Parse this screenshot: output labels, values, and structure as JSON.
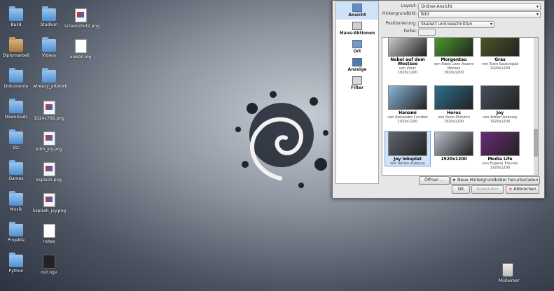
{
  "desktop": {
    "icons": [
      {
        "label": "Build",
        "type": "folder"
      },
      {
        "label": "Studium",
        "type": "folder-img"
      },
      {
        "label": "screenshot2.png",
        "type": "img"
      },
      {
        "label": "Diplomarbeit",
        "type": "folder-brown"
      },
      {
        "label": "Videos",
        "type": "folder-video"
      },
      {
        "label": "unison.log",
        "type": "txt"
      },
      {
        "label": "Dokumente",
        "type": "folder"
      },
      {
        "label": "wheezy_artwork",
        "type": "folder"
      },
      {
        "label": "Downloads",
        "type": "folder-green"
      },
      {
        "label": "1024x768.png",
        "type": "img"
      },
      {
        "label": "Etc",
        "type": "folder"
      },
      {
        "label": "kdm_joy.png",
        "type": "img"
      },
      {
        "label": "Games",
        "type": "folder-red"
      },
      {
        "label": "ksplash.png",
        "type": "img"
      },
      {
        "label": "Musik",
        "type": "folder-green"
      },
      {
        "label": "ksplash_joy.png",
        "type": "img"
      },
      {
        "label": "Projekte",
        "type": "folder"
      },
      {
        "label": "notes",
        "type": "txt"
      },
      {
        "label": "Python",
        "type": "folder"
      },
      {
        "label": "out.ogv",
        "type": "video"
      }
    ],
    "trash_label": "Mülleimer"
  },
  "dialog": {
    "sidebar": [
      {
        "label": "Ansicht",
        "icon": "monitor-icon",
        "active": true
      },
      {
        "label": "Maus-Aktionen",
        "icon": "mouse-icon",
        "active": false
      },
      {
        "label": "Ort",
        "icon": "window-icon",
        "active": false
      },
      {
        "label": "Anzeige",
        "icon": "display-icon",
        "active": false
      },
      {
        "label": "Filter",
        "icon": "funnel-icon",
        "active": false
      }
    ],
    "layout_label": "Layout:",
    "layout_value": "Ordner-Ansicht",
    "background_label": "Hintergrundbild:",
    "background_value": "Bild",
    "position_label": "Positionierung:",
    "position_value": "Skaliert und beschnitten",
    "color_label": "Farbe:",
    "wallpapers": [
      {
        "name": "Nebel auf dem Westsee",
        "author": "von Vinac",
        "size": "1920x1200",
        "color": "#d9d9d9"
      },
      {
        "name": "Morgentau",
        "author": "von Pablo León-Asuero Moreno",
        "size": "1920x1200",
        "color": "#4ea52e"
      },
      {
        "name": "Gras",
        "author": "von Risto Saukonpää",
        "size": "1920x1200",
        "color": "#4f5a28"
      },
      {
        "name": "Hanami",
        "author": "von Alexandre Courbot",
        "size": "1920x1200",
        "color": "#8ab6d9"
      },
      {
        "name": "Horos",
        "author": "von Nuno Pinheiro",
        "size": "1920x1200",
        "color": "#2d6f8c"
      },
      {
        "name": "Joy",
        "author": "von Adrien Auboury",
        "size": "1920x1200",
        "color": "#47505d"
      },
      {
        "name": "Joy Inksplat",
        "author": "von Adrien Auboury",
        "size": "",
        "color": "#5f6672"
      },
      {
        "name": "1920x1200",
        "author": "",
        "size": "",
        "color": "#b8c1cc"
      },
      {
        "name": "Media Life",
        "author": "von Eugene Trounev",
        "size": "1920x1200",
        "color": "#6a2b7a"
      }
    ],
    "open_button": "Öffnen ...",
    "download_button": "Neue Hintergrundbilder herunterladen ...",
    "ok_button": "OK",
    "apply_button": "Anwenden",
    "cancel_button": "Abbrechen"
  }
}
